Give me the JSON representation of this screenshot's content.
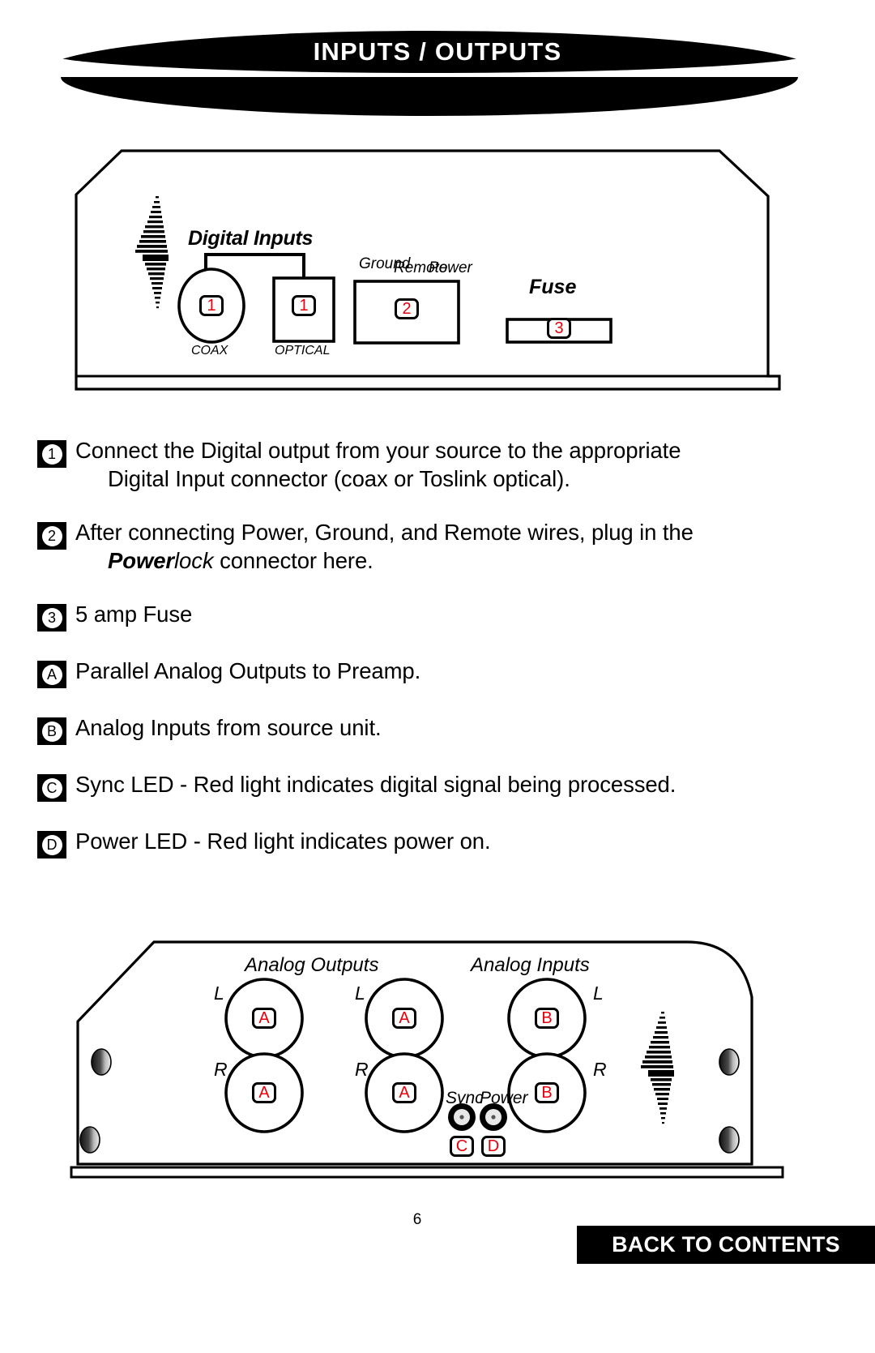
{
  "header": {
    "title": "INPUTS / OUTPUTS"
  },
  "top_panel": {
    "logo": "lightning-bolt-logo",
    "digital_inputs_label": "Digital Inputs",
    "coax_label": "COAX",
    "optical_label": "OPTICAL",
    "powerlock_labels": [
      "Ground",
      "Remote",
      "Power"
    ],
    "fuse_label": "Fuse",
    "callouts": {
      "coax": "1",
      "optical": "1",
      "powerlock": "2",
      "fuse": "3"
    }
  },
  "notes": [
    {
      "marker": "1",
      "text": "Connect the Digital output from your source to the appropriate",
      "continuation": "Digital Input connector (coax or Toslink optical)."
    },
    {
      "marker": "2",
      "text": "After connecting Power, Ground, and Remote wires, plug in the",
      "continuation_bold": "Power",
      "continuation_italic": "lock",
      "continuation_rest": " connector here."
    },
    {
      "marker": "3",
      "text": "5 amp Fuse"
    },
    {
      "marker": "A",
      "text": "Parallel Analog Outputs to Preamp."
    },
    {
      "marker": "B",
      "text": "Analog Inputs from source unit."
    },
    {
      "marker": "C",
      "text": "Sync LED - Red light  indicates digital signal being processed."
    },
    {
      "marker": "D",
      "text": "Power LED - Red light indicates power on."
    }
  ],
  "bottom_panel": {
    "analog_outputs_label": "Analog Outputs",
    "analog_inputs_label": "Analog Inputs",
    "channel_labels": {
      "out1_l": "L",
      "out1_r": "R",
      "out2_l": "L",
      "out2_r": "R",
      "in_l": "L",
      "in_r": "R"
    },
    "led_labels": {
      "sync": "Sync",
      "power": "Power"
    },
    "callouts": {
      "out1_l": "A",
      "out1_r": "A",
      "out2_l": "A",
      "out2_r": "A",
      "in_l": "B",
      "in_r": "B",
      "sync_led": "C",
      "power_led": "D"
    },
    "logo": "lightning-bolt-logo"
  },
  "footer": {
    "page_number": "6",
    "back_to_contents": "BACK TO CONTENTS"
  },
  "colors": {
    "callout_red": "#e8000b",
    "ink": "#000000",
    "paper": "#ffffff"
  }
}
